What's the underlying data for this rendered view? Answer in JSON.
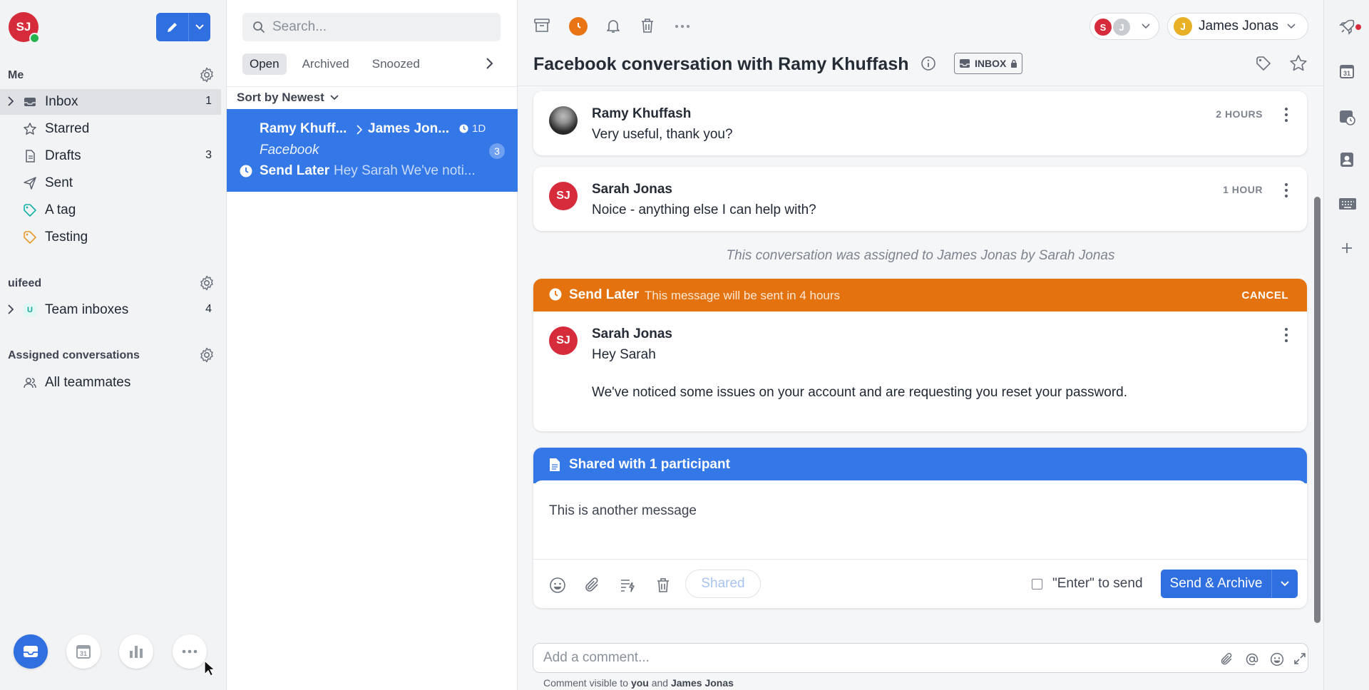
{
  "user": {
    "initials": "SJ"
  },
  "sidebar": {
    "me_label": "Me",
    "items": [
      {
        "label": "Inbox",
        "count": "1"
      },
      {
        "label": "Starred",
        "count": ""
      },
      {
        "label": "Drafts",
        "count": "3"
      },
      {
        "label": "Sent",
        "count": ""
      },
      {
        "label": "A tag",
        "count": ""
      },
      {
        "label": "Testing",
        "count": ""
      }
    ],
    "workspace_label": "uifeed",
    "team": {
      "badge": "U",
      "label": "Team inboxes",
      "count": "4"
    },
    "assigned_label": "Assigned conversations",
    "teammates_label": "All teammates"
  },
  "list": {
    "search_placeholder": "Search...",
    "tabs": [
      "Open",
      "Archived",
      "Snoozed"
    ],
    "sort_label": "Sort by Newest",
    "conversation": {
      "from": "Ramy Khuff...",
      "to": "James Jon...",
      "time": "1D",
      "channel": "Facebook",
      "count": "3",
      "status": "Send Later",
      "preview": "Hey Sarah We've noti..."
    }
  },
  "main": {
    "title": "Facebook conversation with Ramy Khuffash",
    "inbox_badge": "INBOX",
    "assignees": [
      "S",
      "J"
    ],
    "owner": {
      "initial": "J",
      "name": "James Jonas"
    },
    "messages": [
      {
        "author": "Ramy Khuffash",
        "body": "Very useful, thank you?",
        "time": "2 HOURS"
      },
      {
        "author": "Sarah Jonas",
        "initials": "SJ",
        "body": "Noice - anything else I can help with?",
        "time": "1 HOUR"
      }
    ],
    "system_note": "This conversation was assigned to James Jonas by Sarah Jonas",
    "send_later": {
      "label": "Send Later",
      "note": "This message will be sent in 4 hours",
      "cancel": "CANCEL",
      "author": "Sarah Jonas",
      "initials": "SJ",
      "line1": "Hey Sarah",
      "line2": "We've noticed some issues on your account and are requesting you reset your password."
    },
    "draft": {
      "shared_label": "Shared with 1 participant",
      "text": "This is another message",
      "shared_pill": "Shared",
      "enter_label": "\"Enter\" to send",
      "send_label": "Send & Archive"
    },
    "comment": {
      "placeholder": "Add a comment...",
      "visibility_prefix": "Comment visible to",
      "you": "you",
      "and": "and",
      "other": "James Jonas"
    }
  },
  "colors": {
    "accent": "#2f6fe0",
    "send_later": "#e4730f",
    "selected_row": "#3477e6",
    "avatar_red": "#d52b3a"
  },
  "icons": [
    "pencil-icon",
    "gear-icon",
    "inbox-icon",
    "star-icon",
    "draft-icon",
    "send-icon",
    "tag-icon",
    "team-icon",
    "search-icon",
    "archive-icon",
    "clock-icon",
    "bell-icon",
    "trash-icon",
    "more-icon",
    "info-icon",
    "lock-icon",
    "kebab-icon",
    "file-icon",
    "emoji-icon",
    "paperclip-icon",
    "canned-response-icon",
    "at-icon",
    "expand-icon",
    "rocket-icon",
    "calendar-icon",
    "contact-icon",
    "keyboard-icon",
    "plus-icon",
    "chart-icon"
  ]
}
